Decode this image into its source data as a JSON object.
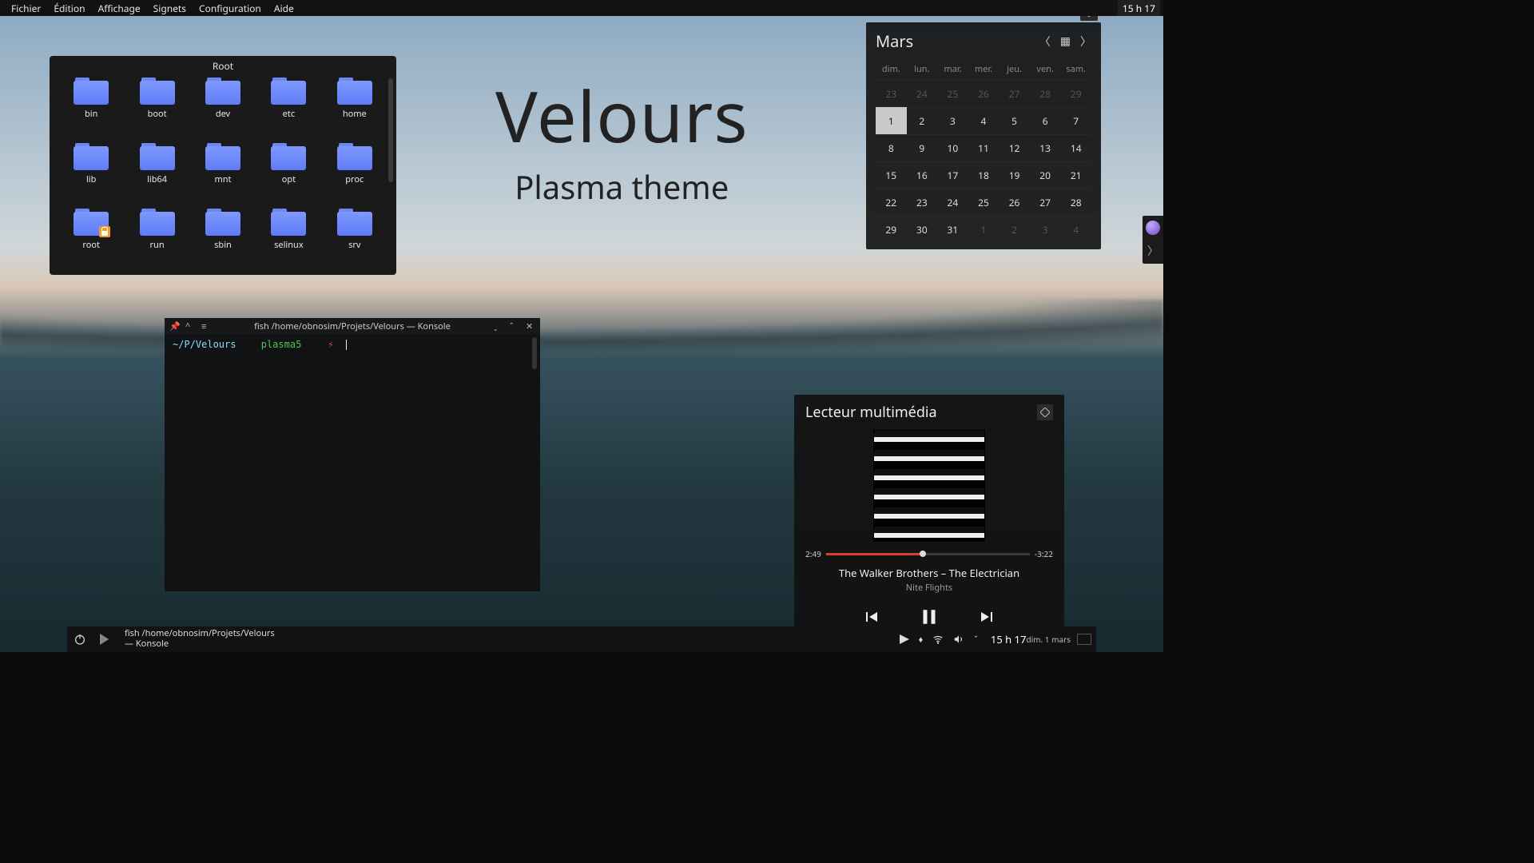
{
  "menubar": {
    "items": [
      "Fichier",
      "Édition",
      "Affichage",
      "Signets",
      "Configuration",
      "Aide"
    ]
  },
  "clock_top": "15 h 17",
  "theme": {
    "title": "Velours",
    "subtitle": "Plasma theme"
  },
  "file_manager": {
    "title": "Root",
    "items": [
      {
        "name": "bin"
      },
      {
        "name": "boot"
      },
      {
        "name": "dev"
      },
      {
        "name": "etc"
      },
      {
        "name": "home"
      },
      {
        "name": "lib"
      },
      {
        "name": "lib64"
      },
      {
        "name": "mnt"
      },
      {
        "name": "opt"
      },
      {
        "name": "proc"
      },
      {
        "name": "root",
        "locked": true
      },
      {
        "name": "run"
      },
      {
        "name": "sbin"
      },
      {
        "name": "selinux"
      },
      {
        "name": "srv"
      }
    ]
  },
  "calendar": {
    "month": "Mars",
    "day_headers": [
      "dim.",
      "lun.",
      "mar.",
      "mer.",
      "jeu.",
      "ven.",
      "sam."
    ],
    "days": [
      {
        "n": 23,
        "dim": true
      },
      {
        "n": 24,
        "dim": true
      },
      {
        "n": 25,
        "dim": true
      },
      {
        "n": 26,
        "dim": true
      },
      {
        "n": 27,
        "dim": true
      },
      {
        "n": 28,
        "dim": true
      },
      {
        "n": 29,
        "dim": true
      },
      {
        "n": 1,
        "sel": true
      },
      {
        "n": 2
      },
      {
        "n": 3
      },
      {
        "n": 4
      },
      {
        "n": 5
      },
      {
        "n": 6
      },
      {
        "n": 7
      },
      {
        "n": 8
      },
      {
        "n": 9
      },
      {
        "n": 10
      },
      {
        "n": 11
      },
      {
        "n": 12
      },
      {
        "n": 13
      },
      {
        "n": 14
      },
      {
        "n": 15
      },
      {
        "n": 16
      },
      {
        "n": 17
      },
      {
        "n": 18
      },
      {
        "n": 19
      },
      {
        "n": 20
      },
      {
        "n": 21
      },
      {
        "n": 22
      },
      {
        "n": 23
      },
      {
        "n": 24
      },
      {
        "n": 25
      },
      {
        "n": 26
      },
      {
        "n": 27
      },
      {
        "n": 28
      },
      {
        "n": 29
      },
      {
        "n": 30
      },
      {
        "n": 31
      },
      {
        "n": 1,
        "dim": true
      },
      {
        "n": 2,
        "dim": true
      },
      {
        "n": 3,
        "dim": true
      },
      {
        "n": 4,
        "dim": true
      }
    ]
  },
  "terminal": {
    "title": "fish /home/obnosim/Projets/Velours — Konsole",
    "prompt_path": "~/P/Velours",
    "prompt_branch": "plasma5",
    "prompt_symbol": "⚡"
  },
  "media_player": {
    "title": "Lecteur multimédia",
    "elapsed": "2:49",
    "remaining": "-3:22",
    "track": "The Walker Brothers – The Electrician",
    "album": "Nite Flights"
  },
  "panel": {
    "task_line1": "fish /home/obnosim/Projets/Velours",
    "task_line2": "— Konsole",
    "clock_time": "15 h 17",
    "clock_date": "dim. 1 mars"
  }
}
